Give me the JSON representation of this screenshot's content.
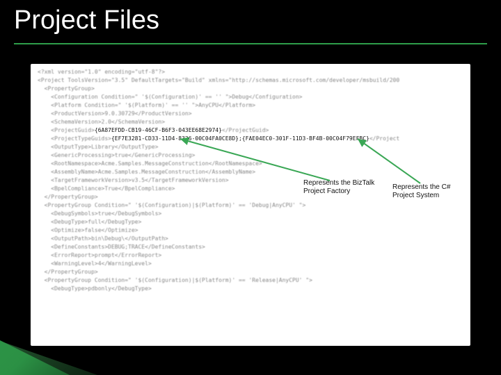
{
  "title": "Project Files",
  "code": {
    "line1": "<?xml version=\"1.0\" encoding=\"utf-8\"?>",
    "line2": "<Project ToolsVersion=\"3.5\" DefaultTargets=\"Build\" xmlns=\"http://schemas.microsoft.com/developer/msbuild/200",
    "line3": "  <PropertyGroup>",
    "line4": "    <Configuration Condition=\" '$(Configuration)' == '' \">Debug</Configuration>",
    "line5": "    <Platform Condition=\" '$(Platform)' == '' \">AnyCPU</Platform>",
    "line6": "    <ProductVersion>9.0.30729</ProductVersion>",
    "line7": "    <SchemaVersion>2.0</SchemaVersion>",
    "line8_pre": "    <ProjectGuid>",
    "guid_project": "{6A87EFDD-CB19-46CF-B6F3-043EE68E2974}",
    "line8_post": "</ProjectGuid>",
    "line9_pre": "    <ProjectTypeGuids>",
    "guid_types": "{EF7E3281-CD33-11D4-8326-00C04FA0CE8D};{FAE04EC0-301F-11D3-BF4B-00C04F79EFBC}",
    "line9_post": "</Project",
    "line10": "    <OutputType>Library</OutputType>",
    "line11": "    <GenericProcessing>true</GenericProcessing>",
    "line12": "    <RootNamespace>Acme.Samples.MessageConstruction</RootNamespace>",
    "line13": "    <AssemblyName>Acme.Samples.MessageConstruction</AssemblyName>",
    "line14": "    <TargetFrameworkVersion>v3.5</TargetFrameworkVersion>",
    "line15": "    <BpelCompliance>True</BpelCompliance>",
    "line16": "  </PropertyGroup>",
    "line17": "  <PropertyGroup Condition=\" '$(Configuration)|$(Platform)' == 'Debug|AnyCPU' \">",
    "line18": "    <DebugSymbols>true</DebugSymbols>",
    "line19": "    <DebugType>full</DebugType>",
    "line20": "    <Optimize>false</Optimize>",
    "line21": "    <OutputPath>bin\\Debug\\</OutputPath>",
    "line22": "    <DefineConstants>DEBUG;TRACE</DefineConstants>",
    "line23": "    <ErrorReport>prompt</ErrorReport>",
    "line24": "    <WarningLevel>4</WarningLevel>",
    "line25": "  </PropertyGroup>",
    "line26": "  <PropertyGroup Condition=\" '$(Configuration)|$(Platform)' == 'Release|AnyCPU' \">",
    "line27": "    <DebugType>pdbonly</DebugType>"
  },
  "annotations": {
    "biztalk": "Represents the BizTalk\nProject Factory",
    "csharp": "Represents the C#\nProject System"
  },
  "colors": {
    "accent": "#2e9e4a",
    "arrow": "#3aa755"
  }
}
